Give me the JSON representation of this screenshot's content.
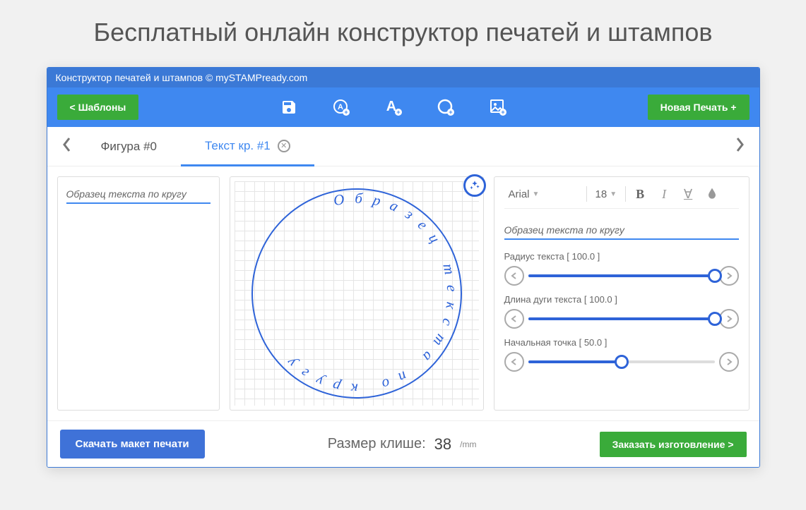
{
  "page": {
    "title": "Бесплатный онлайн конструктор печатей и штампов"
  },
  "titlebar": "Конструктор печатей и штампов © mySTAMPready.com",
  "toolbar": {
    "templates": "<  Шаблоны",
    "new_stamp": "Новая Печать +"
  },
  "tabs": {
    "items": [
      {
        "label": "Фигура #0",
        "active": false
      },
      {
        "label": "Текст кр. #1",
        "active": true
      }
    ]
  },
  "left": {
    "sample": "Образец текста по кругу"
  },
  "right": {
    "font": "Arial",
    "fontsize": "18",
    "sample": "Образец текста по кругу",
    "sliders": [
      {
        "label": "Радиус текста [ 100.0 ]",
        "value": 100
      },
      {
        "label": "Длина дуги текста [ 100.0 ]",
        "value": 100
      },
      {
        "label": "Начальная точка [ 50.0 ]",
        "value": 50
      }
    ]
  },
  "footer": {
    "download": "Скачать макет печати",
    "size_label": "Размер клише:",
    "size_value": "38",
    "size_unit": "/mm",
    "order": "Заказать изготовление >"
  },
  "canvas": {
    "circle_text": "Образец текста по кругу"
  }
}
